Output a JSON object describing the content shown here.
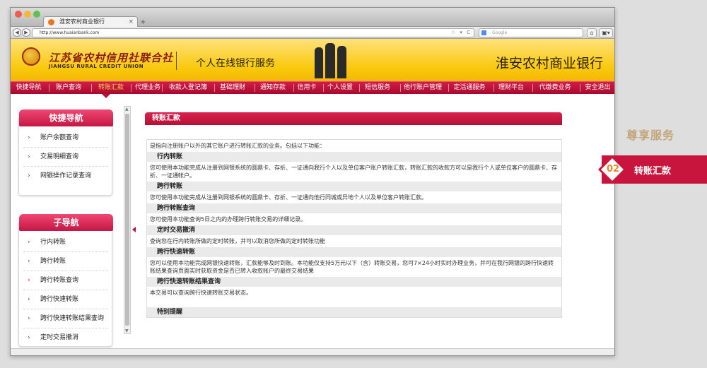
{
  "browser": {
    "tab_title": "淮安农村商业银行",
    "url": "http://www.huaianbank.com",
    "search_placeholder": "Google",
    "new_tab": "+"
  },
  "banner": {
    "logo_cn": "江苏省农村信用社联合社",
    "logo_en": "JIANGSU RURAL CREDIT UNION",
    "service": "个人在线银行服务",
    "bank_name": "淮安农村商业银行"
  },
  "nav": [
    {
      "label": "快捷导航"
    },
    {
      "label": "账户查询"
    },
    {
      "label": "转账汇款"
    },
    {
      "label": "代理业务"
    },
    {
      "label": "收款人登记簿"
    },
    {
      "label": "基础理财"
    },
    {
      "label": "通知存款"
    },
    {
      "label": "信用卡"
    },
    {
      "label": "个人设置"
    },
    {
      "label": "短信服务"
    },
    {
      "label": "他行账户管理"
    },
    {
      "label": "定活通服务"
    },
    {
      "label": "理财平台"
    },
    {
      "label": "代缴费业务"
    },
    {
      "label": "安全退出"
    }
  ],
  "sidebar": {
    "quick": {
      "title": "快捷导航",
      "items": [
        {
          "label": "账户余额查询"
        },
        {
          "label": "交易明细查询"
        },
        {
          "label": "网银操作记录查询"
        }
      ]
    },
    "sub": {
      "title": "子导航",
      "items": [
        {
          "label": "行内转账"
        },
        {
          "label": "跨行转账"
        },
        {
          "label": "跨行转账查询"
        },
        {
          "label": "跨行快速转账"
        },
        {
          "label": "跨行快速转账结果查询"
        },
        {
          "label": "定时交易撤消"
        }
      ]
    }
  },
  "content": {
    "title": "转账汇款",
    "intro": "是指向注册账户以外的其它账户进行转账汇款的业务。包括以下功能：",
    "sections": [
      {
        "heading": "行内转账",
        "text": "您可使用本功能完成从注册到网银系统的圆鼎卡、存折、一证通向我行个人以及单位客户账户转账汇款，转账汇款的收款方可以是我行个人或单位客户的圆鼎卡、存折、一证通帐户。"
      },
      {
        "heading": "跨行转账",
        "text": "您可使用本功能完成从注册到网银系统的圆鼎卡、存折、一证通向他行同城或异地个人以及单位客户转账汇款。"
      },
      {
        "heading": "跨行转账查询",
        "text": "您可使用本功能查询5日之内的办理跨行转账交易的详细记录。"
      },
      {
        "heading": "定时交易撤消",
        "text": "查询您在行内转账所做的定时转账，并可以取消您所做的定时转账功能"
      },
      {
        "heading": "跨行快速转账",
        "text": "您可以使用本功能完成网银快速转账，汇款能够及时到账。本功能仅支持5万元以下（含）转账交易，您可7×24小时实时办理业务，并可在我行网银的跨行快速转账结果查询页面实时获取资金是否已转入收款账户的最终交易结果"
      },
      {
        "heading": "跨行快速转账结果查询",
        "text": "本交易可以查询跨行快速转账交易状态。"
      }
    ],
    "notice_heading": "特别提醒"
  },
  "promo": {
    "title": "尊享服务",
    "number": "02",
    "label": "转账汇款"
  },
  "colors": {
    "brand_red": "#c8153e",
    "banner_yellow": "#f9c80c",
    "nav_active": "#ffd34a"
  }
}
